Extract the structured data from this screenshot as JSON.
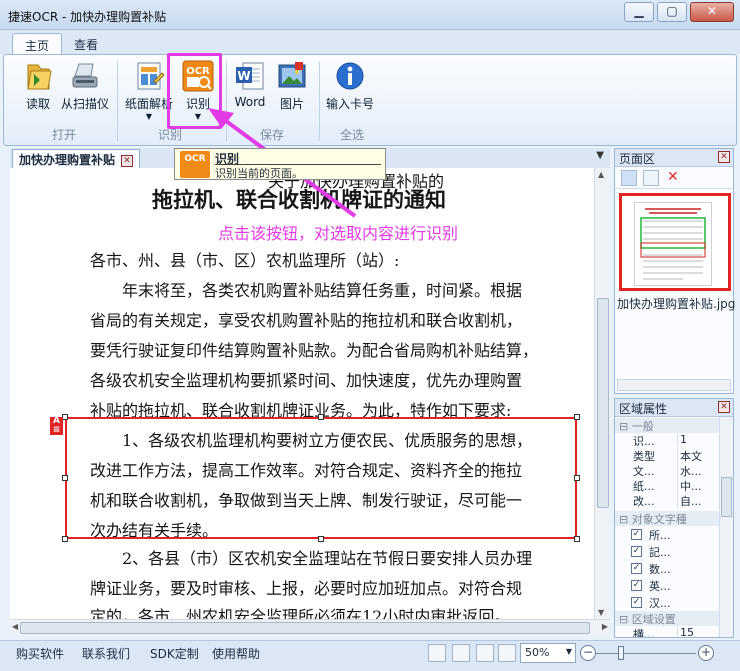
{
  "window": {
    "title": "捷速OCR - 加快办理购置补贴"
  },
  "menu_tabs": [
    "主页",
    "查看"
  ],
  "ribbon": {
    "buttons": {
      "read": "读取",
      "scanner": "从扫描仪",
      "paper_parse": "纸面解析",
      "recognize": "识别",
      "word": "Word",
      "image": "图片",
      "input_card": "输入卡号"
    },
    "groups": {
      "open": "打开",
      "recognize": "识别",
      "save": "保存",
      "select_all": "全选"
    }
  },
  "tooltip": {
    "title": "识别",
    "description": "识别当前的页面。",
    "icon_text": "OCR"
  },
  "document": {
    "tab_label": "加快办理购置补贴",
    "heading_partial": "关于加快办理购置补贴的",
    "heading": "拖拉机、联合收割机牌证的通知",
    "instruction": "点击该按钮，对选取内容进行识别",
    "lines": [
      "各市、州、县（市、区）农机监理所（站）:",
      "年末将至，各类农机购置补贴结算任务重，时间紧。根据",
      "省局的有关规定，享受农机购置补贴的拖拉机和联合收割机，",
      "要凭行驶证复印件结算购置补贴款。为配合省局购机补贴结算，",
      "各级农机安全监理机构要抓紧时间、加快速度，优先办理购置",
      "补贴的拖拉机、联合收割机牌证业务。为此，特作如下要求:",
      "1、各级农机监理机构要树立方便农民、优质服务的思想，",
      "改进工作方法，提高工作效率。对符合规定、资料齐全的拖拉",
      "机和联合收割机，争取做到当天上牌、制发行驶证，尽可能一",
      "次办结有关手续。",
      "2、各县（市）区农机安全监理站在节假日要安排人员办理",
      "牌证业务，要及时审核、上报，必要时应加班加点。对符合规",
      "定的，各市、州农机安全监理所必须在12小时内审批返回。"
    ]
  },
  "page_panel": {
    "title": "页面区",
    "thumbnail_name": "加快办理购置补贴.jpg"
  },
  "props_panel": {
    "title": "区域属性",
    "sections": {
      "general": "一般",
      "object_text": "对象文字種",
      "region_settings": "区域设置"
    },
    "rows": [
      {
        "key": "识...",
        "value": "1"
      },
      {
        "key": "类型",
        "value": "本文"
      },
      {
        "key": "文...",
        "value": "水..."
      },
      {
        "key": "纸...",
        "value": "中..."
      },
      {
        "key": "改...",
        "value": "自..."
      }
    ],
    "checkboxes": [
      "所...",
      "記...",
      "数...",
      "英...",
      "汉..."
    ],
    "last_row": {
      "key": "横...",
      "value": "15"
    }
  },
  "statusbar": {
    "links": [
      "购买软件",
      "联系我们",
      "SDK定制",
      "使用帮助"
    ],
    "zoom": "50%"
  },
  "colors": {
    "highlight": "#e23be6",
    "selection": "#e02424",
    "ocr_orange": "#f08a16"
  }
}
